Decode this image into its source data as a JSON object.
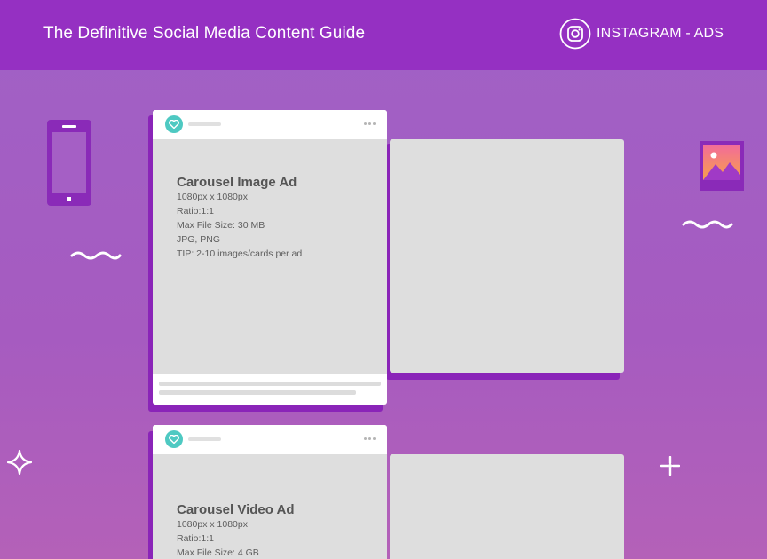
{
  "header": {
    "title": "The Definitive Social Media Content Guide",
    "section": "INSTAGRAM - ADS",
    "icon": "instagram-icon"
  },
  "colors": {
    "header_bg": "#9530c2",
    "accent_teal": "#4ec9c2",
    "card_shadow": "#8a24b8"
  },
  "ads": [
    {
      "title": "Carousel Image Ad",
      "size": "1080px x 1080px",
      "ratio": "Ratio:1:1",
      "max_file_size": "Max File Size: 30 MB",
      "formats": "JPG, PNG",
      "tip": "TIP: 2-10 images/cards per ad"
    },
    {
      "title": "Carousel Video Ad",
      "size": "1080px x 1080px",
      "ratio": "Ratio:1:1",
      "max_file_size": "Max File Size: 4 GB"
    }
  ]
}
